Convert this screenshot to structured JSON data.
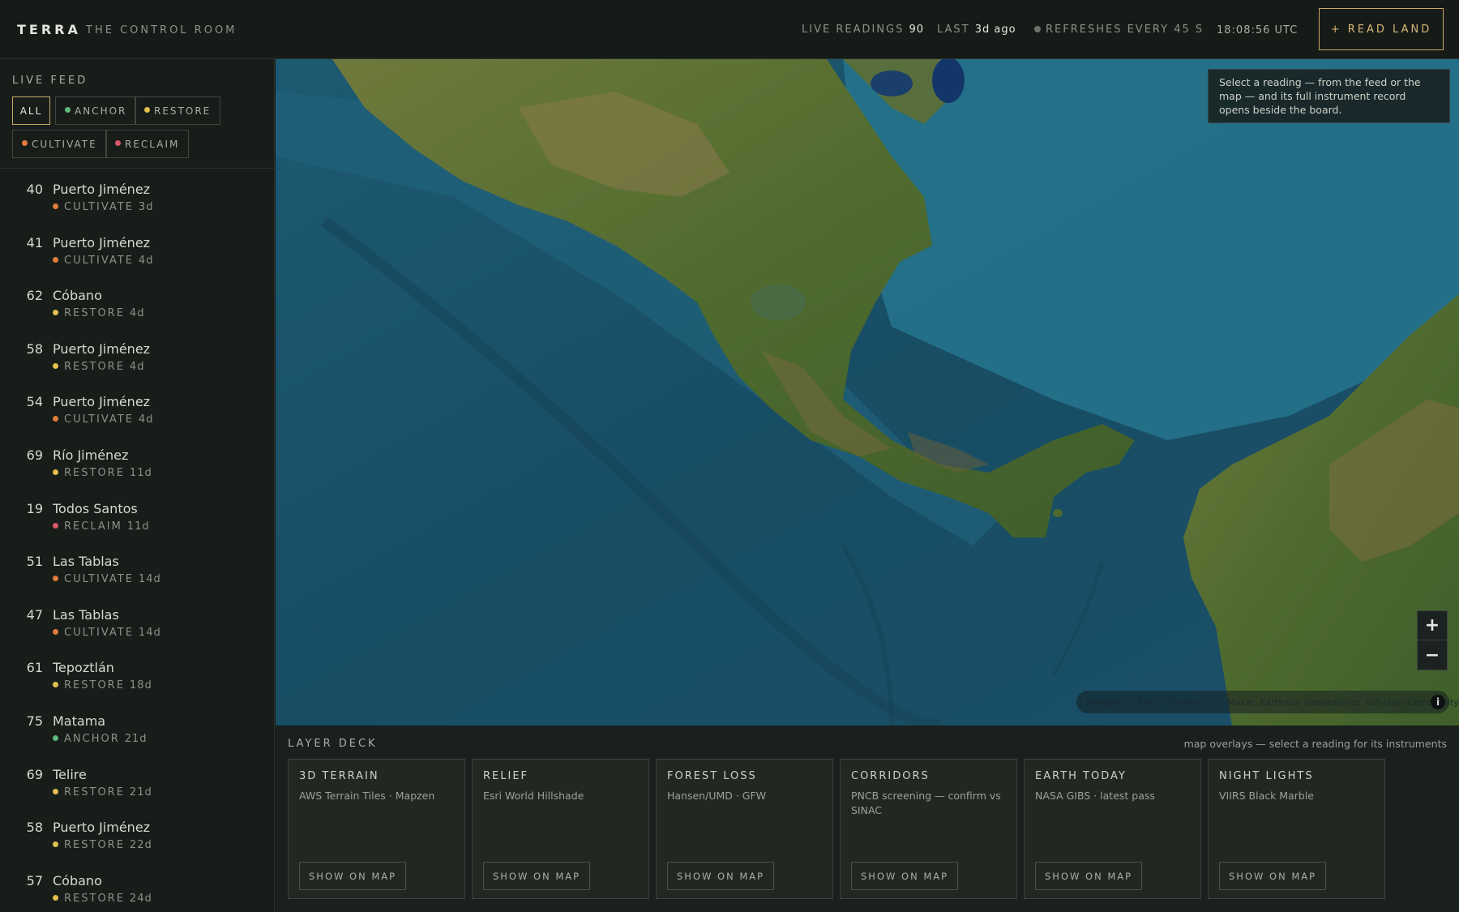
{
  "header": {
    "brand": "TERRA",
    "subtitle": "THE CONTROL ROOM",
    "live_readings_label": "LIVE READINGS",
    "live_readings_value": "90",
    "last_label": "LAST",
    "last_value": "3d ago",
    "refresh_label": "REFRESHES EVERY 45 S",
    "clock": "18:08:56 UTC",
    "read_land_button": "+ READ LAND"
  },
  "feed": {
    "title": "LIVE FEED",
    "filters": [
      {
        "label": "ALL",
        "active": true,
        "color": ""
      },
      {
        "label": "ANCHOR",
        "active": false,
        "color": "#5fb87e"
      },
      {
        "label": "RESTORE",
        "active": false,
        "color": "#e4c04d"
      },
      {
        "label": "CULTIVATE",
        "active": false,
        "color": "#e07c3c"
      },
      {
        "label": "RECLAIM",
        "active": false,
        "color": "#d9586a"
      }
    ],
    "items": [
      {
        "score": "40",
        "place": "Puerto Jiménez",
        "category": "CULTIVATE",
        "age": "3d",
        "color": "#e07c3c"
      },
      {
        "score": "41",
        "place": "Puerto Jiménez",
        "category": "CULTIVATE",
        "age": "4d",
        "color": "#e07c3c"
      },
      {
        "score": "62",
        "place": "Cóbano",
        "category": "RESTORE",
        "age": "4d",
        "color": "#e4c04d"
      },
      {
        "score": "58",
        "place": "Puerto Jiménez",
        "category": "RESTORE",
        "age": "4d",
        "color": "#e4c04d"
      },
      {
        "score": "54",
        "place": "Puerto Jiménez",
        "category": "CULTIVATE",
        "age": "4d",
        "color": "#e07c3c"
      },
      {
        "score": "69",
        "place": "Río Jiménez",
        "category": "RESTORE",
        "age": "11d",
        "color": "#e4c04d"
      },
      {
        "score": "19",
        "place": "Todos Santos",
        "category": "RECLAIM",
        "age": "11d",
        "color": "#d9586a"
      },
      {
        "score": "51",
        "place": "Las Tablas",
        "category": "CULTIVATE",
        "age": "14d",
        "color": "#e07c3c"
      },
      {
        "score": "47",
        "place": "Las Tablas",
        "category": "CULTIVATE",
        "age": "14d",
        "color": "#e07c3c"
      },
      {
        "score": "61",
        "place": "Tepoztlán",
        "category": "RESTORE",
        "age": "18d",
        "color": "#e4c04d"
      },
      {
        "score": "75",
        "place": "Matama",
        "category": "ANCHOR",
        "age": "21d",
        "color": "#5fb87e"
      },
      {
        "score": "69",
        "place": "Telire",
        "category": "RESTORE",
        "age": "21d",
        "color": "#e4c04d"
      },
      {
        "score": "58",
        "place": "Puerto Jiménez",
        "category": "RESTORE",
        "age": "22d",
        "color": "#e4c04d"
      },
      {
        "score": "57",
        "place": "Cóbano",
        "category": "RESTORE",
        "age": "24d",
        "color": "#e4c04d"
      }
    ]
  },
  "map": {
    "hint": "Select a reading — from the feed or the map — and its full instrument record opens beside the board.",
    "zoom_in": "+",
    "zoom_out": "−",
    "attribution": "Imagery © Esri — Source: Esri, Maxar, Earthstar Geographics, GIS User Community",
    "info_icon": "i"
  },
  "deck": {
    "title": "LAYER DECK",
    "note": "map overlays — select a reading for its instruments",
    "cards": [
      {
        "title": "3D TERRAIN",
        "source": "AWS Terrain Tiles · Mapzen",
        "button": "SHOW ON MAP"
      },
      {
        "title": "RELIEF",
        "source": "Esri World Hillshade",
        "button": "SHOW ON MAP"
      },
      {
        "title": "FOREST LOSS",
        "source": "Hansen/UMD · GFW",
        "button": "SHOW ON MAP"
      },
      {
        "title": "CORRIDORS",
        "source": "PNCB screening — confirm vs SINAC",
        "button": "SHOW ON MAP"
      },
      {
        "title": "EARTH TODAY",
        "source": "NASA GIBS · latest pass",
        "button": "SHOW ON MAP"
      },
      {
        "title": "NIGHT LIGHTS",
        "source": "VIIRS Black Marble",
        "button": "SHOW ON MAP"
      }
    ]
  }
}
